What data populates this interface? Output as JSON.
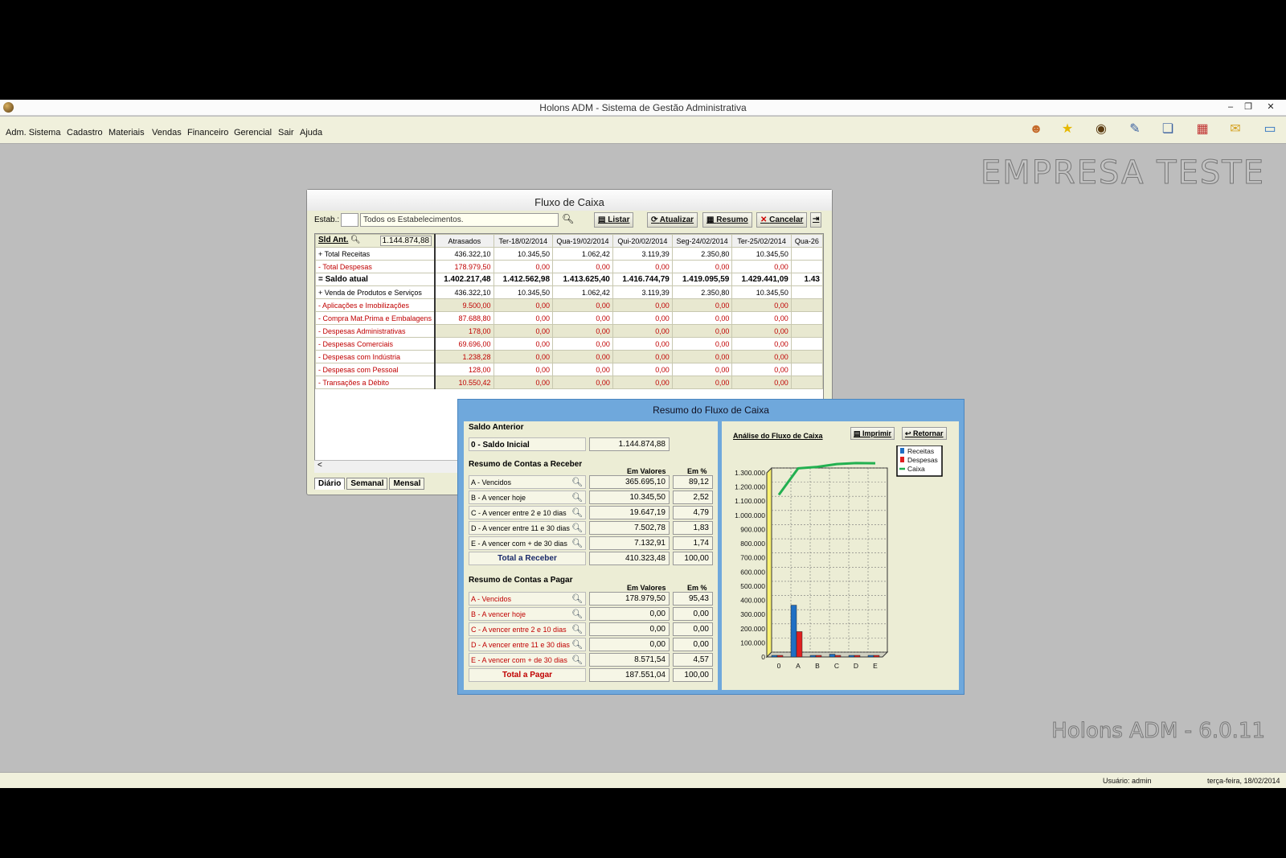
{
  "window": {
    "title": "Holons ADM - Sistema de Gestão Administrativa",
    "minimize": "–",
    "restore": "❐",
    "close": "✕"
  },
  "menu": [
    "Adm. Sistema",
    "Cadastro",
    "Materiais",
    "Vendas",
    "Financeiro",
    "Gerencial",
    "Sair",
    "Ajuda"
  ],
  "toolbar_icons": [
    "user-icon",
    "star-icon",
    "globe-icon",
    "edit-icon",
    "documents-icon",
    "calendar-icon",
    "notes-icon",
    "window-icon"
  ],
  "company_name": "EMPRESA TESTE",
  "version_text": "Holons ADM - 6.0.11",
  "status": {
    "user": "Usuário: admin",
    "date": "terça-feira, 18/02/2014"
  },
  "fluxo": {
    "title": "Fluxo de Caixa",
    "estab_label": "Estab.:",
    "estab_value": "Todos os Estabelecimentos.",
    "buttons": {
      "listar": "Listar",
      "atualizar": "Atualizar",
      "resumo": "Resumo",
      "cancelar": "Cancelar"
    },
    "sld_ant_label": "Sld Ant.",
    "sld_ant_value": "1.144.874,88",
    "columns": [
      "Atrasados",
      "Ter-18/02/2014",
      "Qua-19/02/2014",
      "Qui-20/02/2014",
      "Seg-24/02/2014",
      "Ter-25/02/2014",
      "Qua-26"
    ],
    "rows": [
      {
        "label": "+ Total Receitas",
        "values": [
          "436.322,10",
          "10.345,50",
          "1.062,42",
          "3.119,39",
          "2.350,80",
          "10.345,50",
          ""
        ],
        "style": ""
      },
      {
        "label": "- Total Despesas",
        "values": [
          "178.979,50",
          "0,00",
          "0,00",
          "0,00",
          "0,00",
          "0,00",
          ""
        ],
        "style": "red"
      },
      {
        "label": "= Saldo atual",
        "values": [
          "1.402.217,48",
          "1.412.562,98",
          "1.413.625,40",
          "1.416.744,79",
          "1.419.095,59",
          "1.429.441,09",
          "1.43"
        ],
        "style": "bold"
      },
      {
        "label": "+ Venda de Produtos e Serviços",
        "values": [
          "436.322,10",
          "10.345,50",
          "1.062,42",
          "3.119,39",
          "2.350,80",
          "10.345,50",
          ""
        ],
        "style": ""
      },
      {
        "label": "- Aplicações e Imobilizações",
        "values": [
          "9.500,00",
          "0,00",
          "0,00",
          "0,00",
          "0,00",
          "0,00",
          ""
        ],
        "style": "red"
      },
      {
        "label": "- Compra Mat.Prima e Embalagens",
        "values": [
          "87.688,80",
          "0,00",
          "0,00",
          "0,00",
          "0,00",
          "0,00",
          ""
        ],
        "style": "red"
      },
      {
        "label": "- Despesas Administrativas",
        "values": [
          "178,00",
          "0,00",
          "0,00",
          "0,00",
          "0,00",
          "0,00",
          ""
        ],
        "style": "red"
      },
      {
        "label": "- Despesas Comerciais",
        "values": [
          "69.696,00",
          "0,00",
          "0,00",
          "0,00",
          "0,00",
          "0,00",
          ""
        ],
        "style": "red"
      },
      {
        "label": "- Despesas com Indústria",
        "values": [
          "1.238,28",
          "0,00",
          "0,00",
          "0,00",
          "0,00",
          "0,00",
          ""
        ],
        "style": "red"
      },
      {
        "label": "- Despesas com Pessoal",
        "values": [
          "128,00",
          "0,00",
          "0,00",
          "0,00",
          "0,00",
          "0,00",
          ""
        ],
        "style": "red"
      },
      {
        "label": "- Transações a Débito",
        "values": [
          "10.550,42",
          "0,00",
          "0,00",
          "0,00",
          "0,00",
          "0,00",
          ""
        ],
        "style": "red"
      }
    ],
    "scroll_left": "<",
    "tabs": [
      "Diário",
      "Semanal",
      "Mensal"
    ]
  },
  "resumo": {
    "title": "Resumo do Fluxo de Caixa",
    "saldo_anterior": {
      "title": "Saldo Anterior",
      "label": "0 - Saldo Inicial",
      "value": "1.144.874,88"
    },
    "receber": {
      "title": "Resumo de Contas a Receber",
      "col_valores": "Em Valores",
      "col_pct": "Em %",
      "rows": [
        {
          "label": "A - Vencidos",
          "value": "365.695,10",
          "pct": "89,12"
        },
        {
          "label": "B - A vencer hoje",
          "value": "10.345,50",
          "pct": "2,52"
        },
        {
          "label": "C - A vencer entre 2 e 10 dias",
          "value": "19.647,19",
          "pct": "4,79"
        },
        {
          "label": "D - A vencer entre 11 e 30 dias",
          "value": "7.502,78",
          "pct": "1,83"
        },
        {
          "label": "E - A vencer com + de 30 dias",
          "value": "7.132,91",
          "pct": "1,74"
        }
      ],
      "total_label": "Total a Receber",
      "total_value": "410.323,48",
      "total_pct": "100,00"
    },
    "pagar": {
      "title": "Resumo de Contas a Pagar",
      "col_valores": "Em Valores",
      "col_pct": "Em %",
      "rows": [
        {
          "label": "A -  Vencidos",
          "value": "178.979,50",
          "pct": "95,43"
        },
        {
          "label": "B - A vencer hoje",
          "value": "0,00",
          "pct": "0,00"
        },
        {
          "label": "C - A vencer entre 2 e 10 dias",
          "value": "0,00",
          "pct": "0,00"
        },
        {
          "label": "D - A vencer entre 11 e 30 dias",
          "value": "0,00",
          "pct": "0,00"
        },
        {
          "label": "E - A vencer com + de 30 dias",
          "value": "8.571,54",
          "pct": "4,57"
        }
      ],
      "total_label": "Total a Pagar",
      "total_value": "187.551,04",
      "total_pct": "100,00"
    },
    "chart_title": "Análise do Fluxo de Caixa",
    "imprimir": "Imprimir",
    "retornar": "Retornar"
  },
  "chart_data": {
    "type": "bar",
    "title": "Análise do Fluxo de Caixa",
    "categories": [
      "0",
      "A",
      "B",
      "C",
      "D",
      "E"
    ],
    "series": [
      {
        "name": "Receitas",
        "type": "bar",
        "color": "#1f6fc4",
        "values": [
          0,
          365695.1,
          10345.5,
          19647.19,
          7502.78,
          7132.91
        ]
      },
      {
        "name": "Despesas",
        "type": "bar",
        "color": "#e02020",
        "values": [
          0,
          178979.5,
          0,
          0,
          0,
          8571.54
        ]
      },
      {
        "name": "Caixa",
        "type": "line",
        "color": "#22b050",
        "values": [
          1144874.88,
          1331590.48,
          1341935.98,
          1361583.17,
          1369085.95,
          1367647.32
        ]
      }
    ],
    "yticks": [
      "0",
      "100.000",
      "200.000",
      "300.000",
      "400.000",
      "500.000",
      "600.000",
      "700.000",
      "800.000",
      "900.000",
      "1.000.000",
      "1.100.000",
      "1.200.000",
      "1.300.000"
    ],
    "ylim": [
      0,
      1300000
    ],
    "grid": true,
    "legend": "top-right"
  }
}
